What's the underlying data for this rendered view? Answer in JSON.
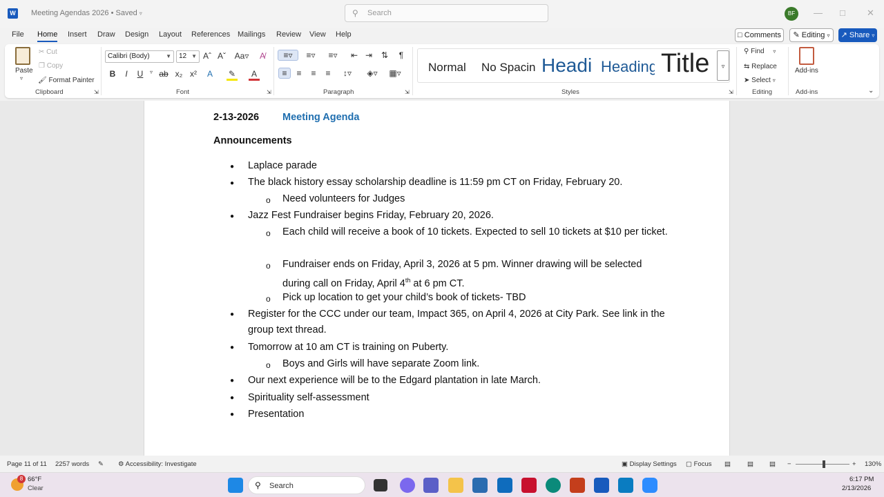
{
  "window": {
    "app_icon_letter": "W",
    "doc_title": "Meeting Agendas 2026 • Saved",
    "search_placeholder": "Search",
    "avatar_initials": "BF"
  },
  "menu": {
    "tabs": [
      "File",
      "Home",
      "Insert",
      "Draw",
      "Design",
      "Layout",
      "References",
      "Mailings",
      "Review",
      "View",
      "Help"
    ],
    "active_tab": "Home",
    "comments_label": "Comments",
    "editing_label": "Editing",
    "share_label": "Share"
  },
  "ribbon": {
    "clipboard": {
      "paste": "Paste",
      "cut": "Cut",
      "copy": "Copy",
      "format_painter": "Format Painter",
      "label": "Clipboard"
    },
    "font": {
      "font_name": "Calibri (Body)",
      "font_size": "12",
      "label": "Font"
    },
    "paragraph": {
      "label": "Paragraph"
    },
    "styles": {
      "items": [
        "Normal",
        "No Spacin",
        "Headi",
        "Heading",
        "Title"
      ],
      "label": "Styles"
    },
    "editing": {
      "find": "Find",
      "replace": "Replace",
      "select": "Select",
      "label": "Editing"
    },
    "addins": {
      "button": "Add-ins",
      "label": "Add-ins"
    }
  },
  "document": {
    "date": "2-13-2026",
    "title": "Meeting Agenda",
    "section": "Announcements",
    "items": {
      "i1": "Laplace parade",
      "i2": "The black history essay scholarship deadline is 11:59 pm CT on Friday, February 20.",
      "i2a": "Need volunteers for Judges",
      "i3": "Jazz Fest Fundraiser begins Friday, February 20, 2026.",
      "i3a": "Each child will receive a book of 10 tickets. Expected to sell 10 tickets at $10 per ticket.",
      "i3b_pre": "Fundraiser ends on Friday, April 3, 2026 at 5 pm. Winner drawing will be selected during call on Friday, April 4",
      "i3b_sup": "th",
      "i3b_post": " at 6 pm CT.",
      "i3c": "Pick up location to get your child’s book of tickets- TBD",
      "i4": "Register for the CCC under our team, Impact 365, on April 4, 2026 at City Park. See link in the group text thread.",
      "i5": "Tomorrow at 10 am CT is training on Puberty.",
      "i5a": "Boys and Girls will have separate Zoom link.",
      "i6": "Our next experience will be to the Edgard plantation in late March.",
      "i7": "Spirituality self-assessment",
      "i8": "Presentation"
    }
  },
  "status": {
    "page": "Page 11 of 11",
    "words": "2257 words",
    "accessibility": "Accessibility: Investigate",
    "display_settings": "Display Settings",
    "focus": "Focus",
    "zoom": "130%"
  },
  "taskbar": {
    "weather_badge": "8",
    "temperature": "66°F",
    "condition": "Clear",
    "search": "Search",
    "time": "6:17 PM",
    "date": "2/13/2026"
  }
}
